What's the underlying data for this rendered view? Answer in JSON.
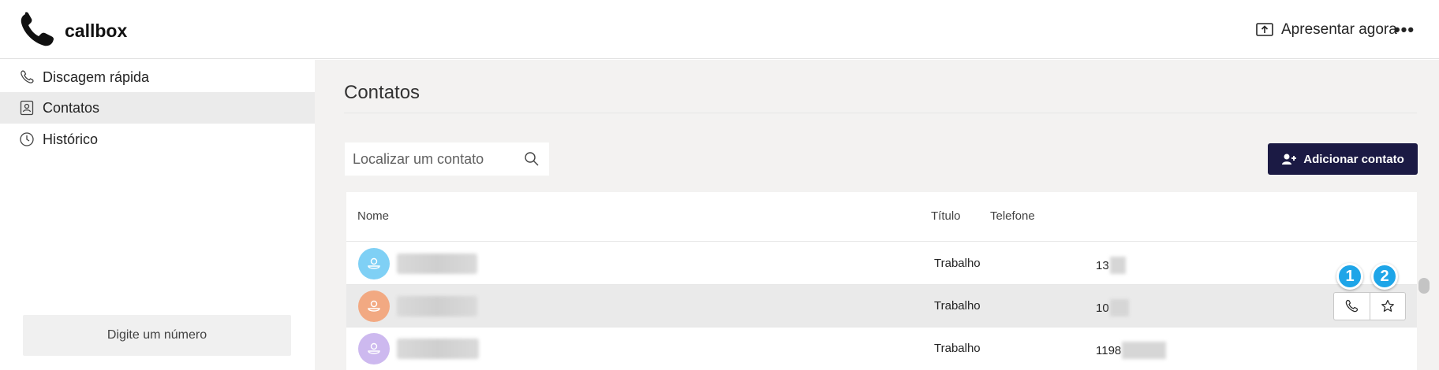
{
  "header": {
    "app_name": "callbox",
    "present_label": "Apresentar agora",
    "more_label": "•••"
  },
  "sidebar": {
    "items": [
      {
        "label": "Discagem rápida",
        "icon": "phone-icon",
        "active": false
      },
      {
        "label": "Contatos",
        "icon": "contact-card-icon",
        "active": true
      },
      {
        "label": "Histórico",
        "icon": "clock-icon",
        "active": false
      }
    ],
    "dial_placeholder": "Digite um número"
  },
  "main": {
    "title": "Contatos",
    "search_placeholder": "Localizar um contato",
    "add_button_label": "Adicionar contato",
    "table": {
      "headers": {
        "name": "Nome",
        "title": "Título",
        "phone": "Telefone"
      },
      "rows": [
        {
          "avatar_color": "#7fd0f5",
          "title": "Trabalho",
          "phone_visible": "13"
        },
        {
          "avatar_color": "#f2a982",
          "title": "Trabalho",
          "phone_visible": "10"
        },
        {
          "avatar_color": "#cdb9ef",
          "title": "Trabalho",
          "phone_visible": "1198"
        }
      ]
    },
    "badges": [
      "1",
      "2"
    ]
  },
  "colors": {
    "accent_dark": "#1b1a44",
    "badge_blue": "#1ea5e8",
    "main_bg": "#f3f2f1"
  }
}
